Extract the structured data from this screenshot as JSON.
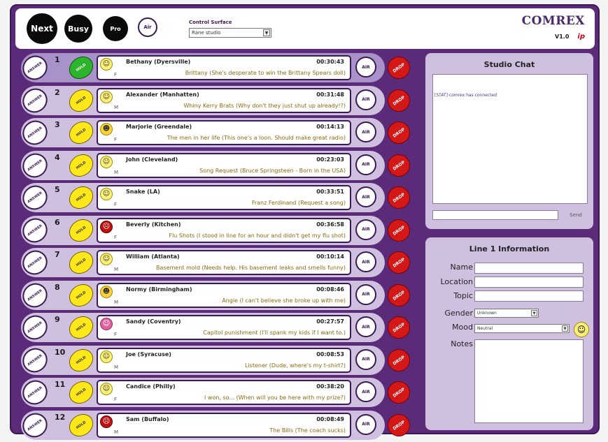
{
  "toolbar": {
    "next_label": "Next",
    "busy_label": "Busy",
    "pro_label": "Pro",
    "air_label": "Air",
    "control_surface_label": "Control Surface",
    "control_surface_value": "Rane studio"
  },
  "logo": {
    "name": "COMREX",
    "sub": "ip",
    "version": "V1.0"
  },
  "row_labels": {
    "answer": "ANSWER",
    "hold": "HOLD",
    "air": "AIR",
    "drop": "DROP"
  },
  "lines": [
    {
      "num": "1",
      "caller": "Bethany (Dyersville)",
      "time": "00:30:43",
      "gender": "F",
      "topic": "Brittany (She's desperate to win the Brittany Spears doll)",
      "mood": "smile",
      "hold": "green"
    },
    {
      "num": "2",
      "caller": "Alexander (Manhatten)",
      "time": "00:31:48",
      "gender": "M",
      "topic": "Whiny Kerry Brats (Why don't they just shut up already!?)",
      "mood": "neutral",
      "hold": "yellow"
    },
    {
      "num": "3",
      "caller": "Marjorie (Greendale)",
      "time": "00:14:13",
      "gender": "F",
      "topic": "The men in her life (This one's a loon. Should make great radio)",
      "mood": "laugh",
      "hold": "yellow"
    },
    {
      "num": "4",
      "caller": "John (Cleveland)",
      "time": "00:23:03",
      "gender": "M",
      "topic": "Song Request (Bruce Springsteen - Born in the USA)",
      "mood": "neutral",
      "hold": "yellow"
    },
    {
      "num": "5",
      "caller": "Snake (LA)",
      "time": "00:33:51",
      "gender": "F",
      "topic": "Franz Ferdinand (Request a song)",
      "mood": "neutral",
      "hold": "yellow"
    },
    {
      "num": "6",
      "caller": "Beverly (Kitchen)",
      "time": "00:36:58",
      "gender": "F",
      "topic": "Flu Shots (I stood in line for an hour and didn't get my flu shot)",
      "mood": "angry",
      "hold": "yellow"
    },
    {
      "num": "7",
      "caller": "William (Atlanta)",
      "time": "00:10:14",
      "gender": "M",
      "topic": "Basement mold (Needs help. His basement leaks and smells funny)",
      "mood": "smile",
      "hold": "yellow"
    },
    {
      "num": "8",
      "caller": "Normy (Birmingham)",
      "time": "00:08:46",
      "gender": "M",
      "topic": "Angie (I can't believe she broke up with me)",
      "mood": "laugh",
      "hold": "yellow"
    },
    {
      "num": "9",
      "caller": "Sandy (Coventry)",
      "time": "00:27:57",
      "gender": "F",
      "topic": "Capitol punishment (I'll spank my kids if I want to.)",
      "mood": "pink",
      "hold": "yellow"
    },
    {
      "num": "10",
      "caller": "Joe (Syracuse)",
      "time": "00:08:53",
      "gender": "M",
      "topic": "Listener (Dude, where's my t-shirt?)",
      "mood": "neutral",
      "hold": "yellow"
    },
    {
      "num": "11",
      "caller": "Candice (Philly)",
      "time": "00:38:20",
      "gender": "F",
      "topic": "I won, so... (When will you be here with my prize?)",
      "mood": "smile",
      "hold": "yellow"
    },
    {
      "num": "12",
      "caller": "Sam (Buffalo)",
      "time": "00:08:49",
      "gender": "M",
      "topic": "The Bills (The coach sucks)",
      "mood": "angry",
      "hold": "yellow"
    }
  ],
  "chat": {
    "title": "Studio Chat",
    "messages": [
      "[STAT] comrex has connected"
    ],
    "send_label": "Send"
  },
  "info": {
    "title": "Line 1 Information",
    "name_label": "Name",
    "location_label": "Location",
    "topic_label": "Topic",
    "gender_label": "Gender",
    "gender_value": "Unknown",
    "mood_label": "Mood",
    "mood_value": "Neutral",
    "notes_label": "Notes"
  },
  "colors": {
    "frame": "#5b2a78",
    "row": "#cfc0e0",
    "hold": "#ffe81a",
    "hold_active": "#2cb52c",
    "drop": "#d41818"
  }
}
